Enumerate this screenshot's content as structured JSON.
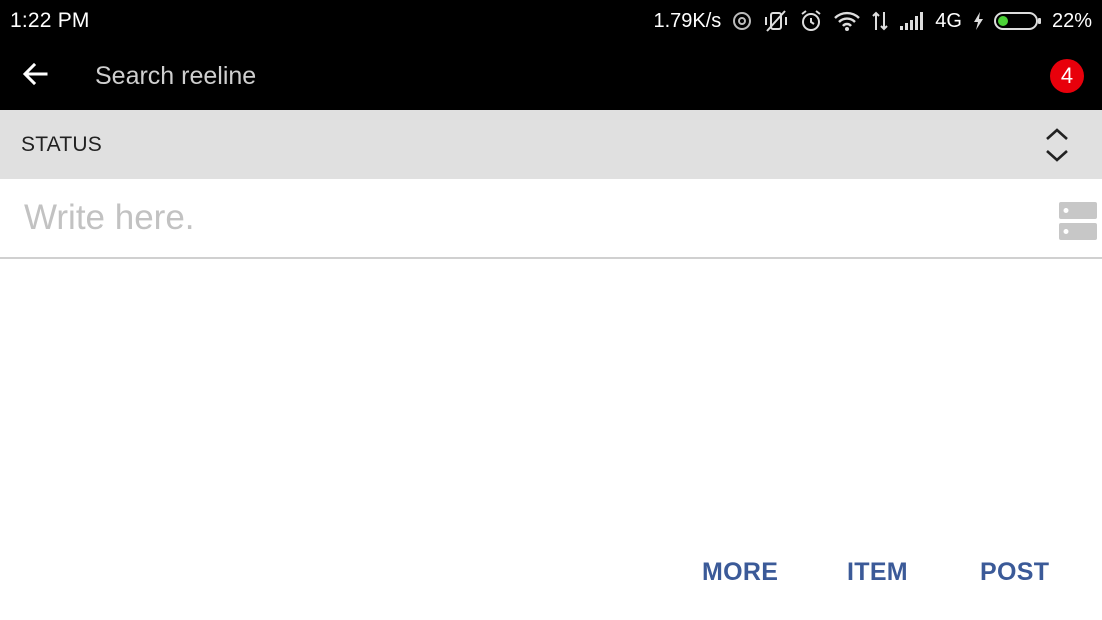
{
  "status_bar": {
    "time": "1:22 PM",
    "network_speed": "1.79K/s",
    "network_type": "4G",
    "battery_percent": "22%",
    "battery_level": 0.22,
    "icons": [
      "sync-icon",
      "vibrate-off-icon",
      "alarm-icon",
      "wifi-icon",
      "data-arrows-icon",
      "signal-icon",
      "charging-icon",
      "battery-icon"
    ]
  },
  "appbar": {
    "search_placeholder": "Search reeline",
    "notification_count": "4",
    "badge_color": "#e8000b"
  },
  "status_section": {
    "label": "STATUS"
  },
  "composer": {
    "placeholder": "Write here."
  },
  "actions": {
    "more": "MORE",
    "item": "ITEM",
    "post": "POST",
    "accent_color": "#3b5a98"
  }
}
